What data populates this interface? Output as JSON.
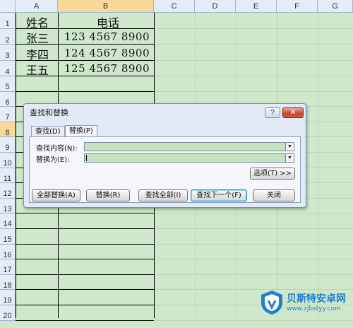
{
  "sheet": {
    "columns": [
      "A",
      "B",
      "C",
      "D",
      "E",
      "F",
      "G"
    ],
    "selected_column": "B",
    "rows": [
      "1",
      "2",
      "3",
      "4",
      "5",
      "6",
      "7",
      "8",
      "9",
      "10",
      "11",
      "12",
      "13",
      "14",
      "15",
      "16",
      "17",
      "18",
      "19",
      "20"
    ],
    "selected_row": "8",
    "header_row": {
      "a": "姓名",
      "b": "电话"
    },
    "records": [
      {
        "name": "张三",
        "phone": "123  4567  8900"
      },
      {
        "name": "李四",
        "phone": "124  4567  8900"
      },
      {
        "name": "王五",
        "phone": "125  4567  8900"
      }
    ]
  },
  "dialog": {
    "title": "查找和替换",
    "help_label": "?",
    "close_label": "✕",
    "tabs": [
      "查找(D)",
      "替换(P)"
    ],
    "active_tab": "替换(P)",
    "find_label": "查找内容(N):",
    "find_value": "",
    "replace_label": "替换为(E):",
    "replace_value": "",
    "options_label": "选项(T) >>",
    "buttons": {
      "replace_all": "全部替换(A)",
      "replace": "替换(R)",
      "find_all": "查找全部(I)",
      "find_next": "查找下一个(F)",
      "close": "关闭"
    }
  },
  "watermark": {
    "name": "贝斯特安卓网",
    "url": "www.zjbstyy.com"
  },
  "colors": {
    "sheet_bg": "#cfe8cc",
    "header_bg": "#e4ecf7",
    "selected_header": "#f9d99a",
    "dialog_bg": "#e1eaf6",
    "close_red": "#c44430",
    "watermark_blue": "#1f7fd0"
  }
}
